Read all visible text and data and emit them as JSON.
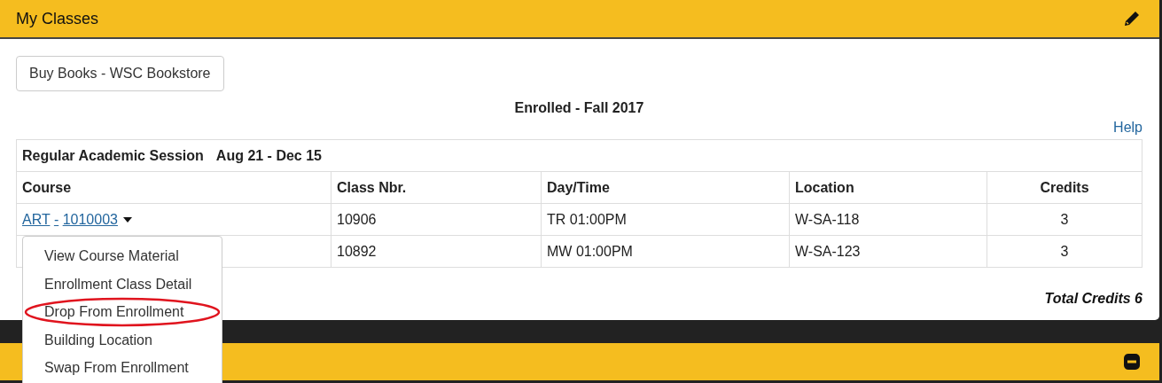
{
  "panel": {
    "title": "My Classes",
    "button": "Buy Books - WSC Bookstore",
    "heading": "Enrolled - Fall 2017",
    "help": "Help",
    "session": {
      "name": "Regular Academic Session",
      "dates": "Aug 21 - Dec 15"
    },
    "columns": [
      "Course",
      "Class Nbr.",
      "Day/Time",
      "Location",
      "Credits"
    ],
    "rows": [
      {
        "subject": "ART",
        "separator": "-",
        "number": "1010003",
        "class_nbr": "10906",
        "day_time": "TR 01:00PM",
        "location": "W-SA-118",
        "credits": "3"
      },
      {
        "class_nbr": "10892",
        "day_time": "MW 01:00PM",
        "location": "W-SA-123",
        "credits": "3"
      }
    ],
    "total": "Total Credits 6"
  },
  "menu": {
    "items": [
      {
        "label": "View Course Material",
        "circled": false
      },
      {
        "label": "Enrollment Class Detail",
        "circled": false
      },
      {
        "label": "Drop From Enrollment",
        "circled": true
      },
      {
        "label": "Building Location",
        "circled": false
      },
      {
        "label": "Swap From Enrollment",
        "circled": false
      }
    ]
  }
}
